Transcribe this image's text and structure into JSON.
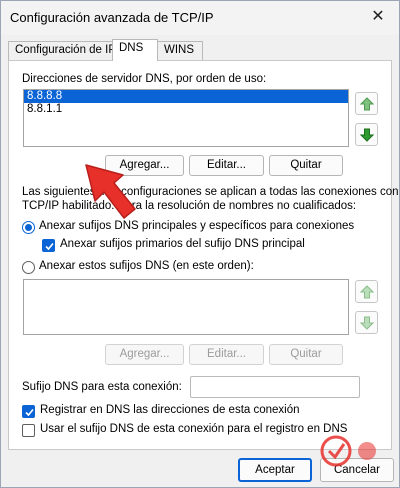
{
  "window": {
    "title": "Configuración avanzada de TCP/IP",
    "close_icon": "close-icon"
  },
  "tabs": [
    {
      "label": "Configuración de IP",
      "active": false
    },
    {
      "label": "DNS",
      "active": true
    },
    {
      "label": "WINS",
      "active": false
    }
  ],
  "dns_servers": {
    "label": "Direcciones de servidor DNS, por orden de uso:",
    "items": [
      "8.8.8.8",
      "8.8.1.1"
    ],
    "selected_index": 0,
    "up_icon": "arrow-up-icon",
    "down_icon": "arrow-down-icon",
    "buttons": {
      "add": "Agregar...",
      "edit": "Editar...",
      "remove": "Quitar"
    }
  },
  "resolution": {
    "description_line1": "Las siguientes tres configuraciones se aplican a todas las conexiones con",
    "description_line2": "TCP/IP habilitado. Para la resolución de nombres no cualificados:",
    "option_primary": "Anexar sufijos DNS principales y específicos para conexiones",
    "option_primary_selected": true,
    "option_parent": "Anexar sufijos primarios del sufijo DNS principal",
    "option_parent_checked": true,
    "option_list": "Anexar estos sufijos DNS (en este orden):",
    "option_list_selected": false,
    "suffix_items": [],
    "buttons": {
      "add": "Agregar...",
      "edit": "Editar...",
      "remove": "Quitar"
    }
  },
  "connection_suffix": {
    "label": "Sufijo DNS para esta conexión:",
    "value": ""
  },
  "registration": {
    "register_label": "Registrar en DNS las direcciones de esta conexión",
    "register_checked": true,
    "use_suffix_label": "Usar el sufijo DNS de esta conexión para el registro en DNS",
    "use_suffix_checked": false
  },
  "footer": {
    "ok": "Aceptar",
    "cancel": "Cancelar"
  },
  "overlay": {
    "pointer_icon": "red-arrow-pointer-icon",
    "watermark_icon": "watermark-logo-icon",
    "accent_color": "#0a64d6",
    "pointer_color": "#e8302b"
  }
}
